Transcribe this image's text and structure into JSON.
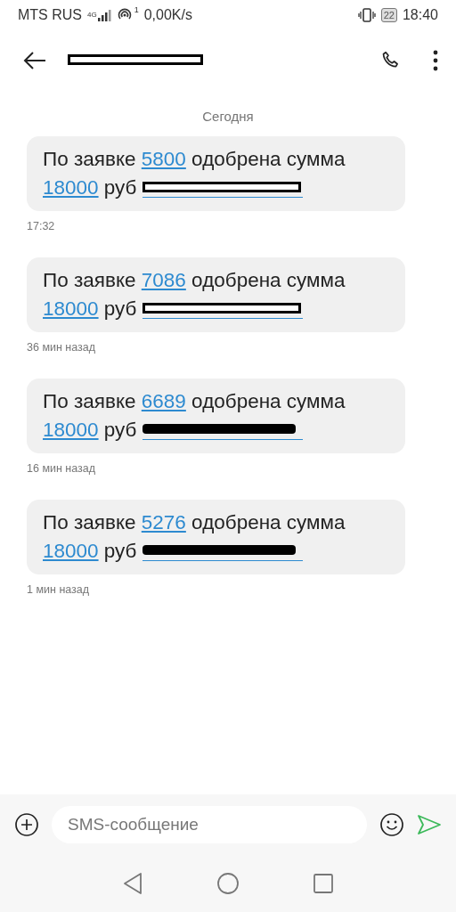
{
  "status_bar": {
    "carrier": "MTS RUS",
    "network": "4G",
    "hotspot_count": "1",
    "speed": "0,00K/s",
    "battery": "22",
    "time": "18:40"
  },
  "header": {
    "title_redaction_outlined": true
  },
  "date_divider": "Сегодня",
  "messages": [
    {
      "prefix": "По заявке",
      "order": "5800",
      "middle": "одобрена сумма",
      "amount": "18000",
      "currency": "руб",
      "redaction_outlined": true,
      "time": "17:32"
    },
    {
      "prefix": "По заявке",
      "order": "7086",
      "middle": "одобрена сумма",
      "amount": "18000",
      "currency": "руб",
      "redaction_outlined": true,
      "time": "36 мин назад"
    },
    {
      "prefix": "По заявке",
      "order": "6689",
      "middle": "одобрена сумма",
      "amount": "18000",
      "currency": "руб",
      "redaction_outlined": false,
      "time": "16 мин назад"
    },
    {
      "prefix": "По заявке",
      "order": "5276",
      "middle": "одобрена сумма",
      "amount": "18000",
      "currency": "руб",
      "redaction_outlined": false,
      "time": "1 мин назад"
    }
  ],
  "composer": {
    "placeholder": "SMS-сообщение"
  }
}
